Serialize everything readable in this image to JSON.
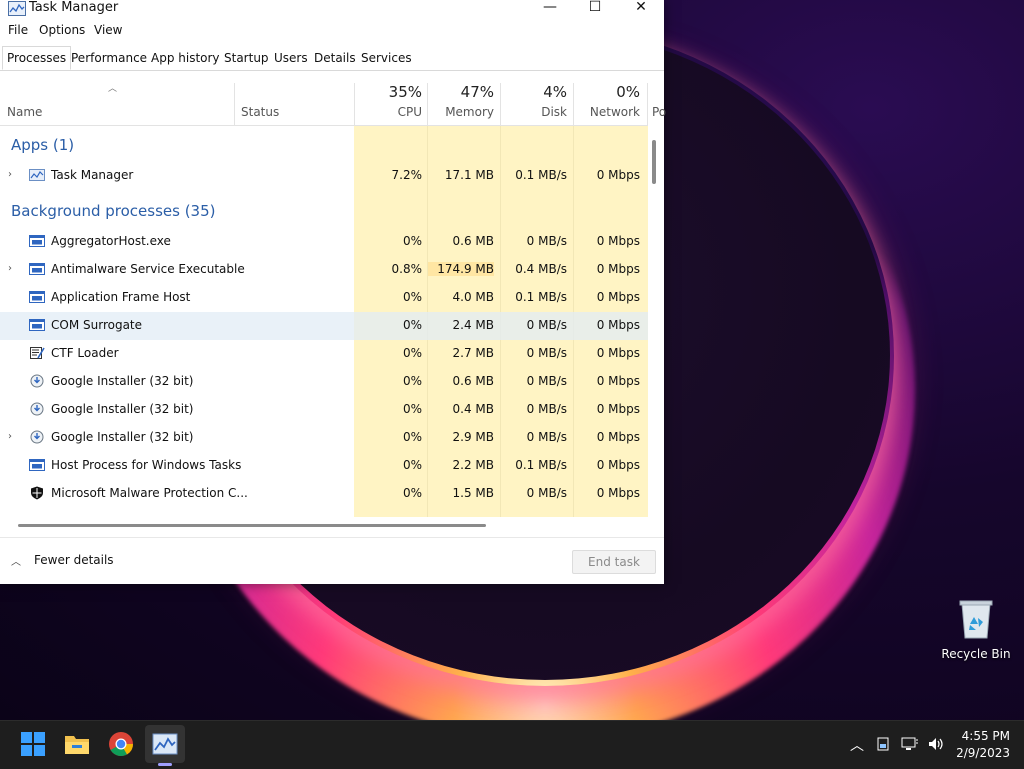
{
  "window": {
    "title": "Task Manager",
    "controls": {
      "minimize": "—",
      "maximize": "☐",
      "close": "✕"
    }
  },
  "menu": [
    "File",
    "Options",
    "View"
  ],
  "tabs": [
    "Processes",
    "Performance",
    "App history",
    "Startup",
    "Users",
    "Details",
    "Services"
  ],
  "columns": {
    "name": "Name",
    "status": "Status",
    "cpu": {
      "pct": "35%",
      "label": "CPU"
    },
    "memory": {
      "pct": "47%",
      "label": "Memory"
    },
    "disk": {
      "pct": "4%",
      "label": "Disk"
    },
    "network": {
      "pct": "0%",
      "label": "Network"
    },
    "power": "Po"
  },
  "groups": {
    "apps": "Apps (1)",
    "background": "Background processes (35)"
  },
  "apps": [
    {
      "name": "Task Manager",
      "cpu": "7.2%",
      "memory": "17.1 MB",
      "disk": "0.1 MB/s",
      "network": "0 Mbps",
      "expandable": true,
      "icon": "taskmanager-icon"
    }
  ],
  "background": [
    {
      "name": "AggregatorHost.exe",
      "cpu": "0%",
      "memory": "0.6 MB",
      "disk": "0 MB/s",
      "network": "0 Mbps",
      "expandable": false,
      "icon": "window-app-icon"
    },
    {
      "name": "Antimalware Service Executable",
      "cpu": "0.8%",
      "memory": "174.9 MB",
      "disk": "0.4 MB/s",
      "network": "0 Mbps",
      "expandable": true,
      "icon": "window-app-icon"
    },
    {
      "name": "Application Frame Host",
      "cpu": "0%",
      "memory": "4.0 MB",
      "disk": "0.1 MB/s",
      "network": "0 Mbps",
      "expandable": false,
      "icon": "window-app-icon"
    },
    {
      "name": "COM Surrogate",
      "cpu": "0%",
      "memory": "2.4 MB",
      "disk": "0 MB/s",
      "network": "0 Mbps",
      "expandable": false,
      "icon": "window-app-icon"
    },
    {
      "name": "CTF Loader",
      "cpu": "0%",
      "memory": "2.7 MB",
      "disk": "0 MB/s",
      "network": "0 Mbps",
      "expandable": false,
      "icon": "ctf-loader-icon"
    },
    {
      "name": "Google Installer (32 bit)",
      "cpu": "0%",
      "memory": "0.6 MB",
      "disk": "0 MB/s",
      "network": "0 Mbps",
      "expandable": false,
      "icon": "installer-icon"
    },
    {
      "name": "Google Installer (32 bit)",
      "cpu": "0%",
      "memory": "0.4 MB",
      "disk": "0 MB/s",
      "network": "0 Mbps",
      "expandable": false,
      "icon": "installer-icon"
    },
    {
      "name": "Google Installer (32 bit)",
      "cpu": "0%",
      "memory": "2.9 MB",
      "disk": "0 MB/s",
      "network": "0 Mbps",
      "expandable": true,
      "icon": "installer-icon"
    },
    {
      "name": "Host Process for Windows Tasks",
      "cpu": "0%",
      "memory": "2.2 MB",
      "disk": "0.1 MB/s",
      "network": "0 Mbps",
      "expandable": false,
      "icon": "window-app-icon"
    },
    {
      "name": "Microsoft Malware Protection C...",
      "cpu": "0%",
      "memory": "1.5 MB",
      "disk": "0 MB/s",
      "network": "0 Mbps",
      "expandable": false,
      "icon": "shield-icon"
    }
  ],
  "footer": {
    "fewer_details": "Fewer details",
    "end_task": "End task"
  },
  "desktop": {
    "recycle_bin": "Recycle Bin"
  },
  "taskbar": {
    "apps": [
      "windows-start-icon",
      "file-explorer-icon",
      "chrome-icon",
      "task-manager-icon"
    ],
    "time": "4:55 PM",
    "date": "2/9/2023"
  }
}
